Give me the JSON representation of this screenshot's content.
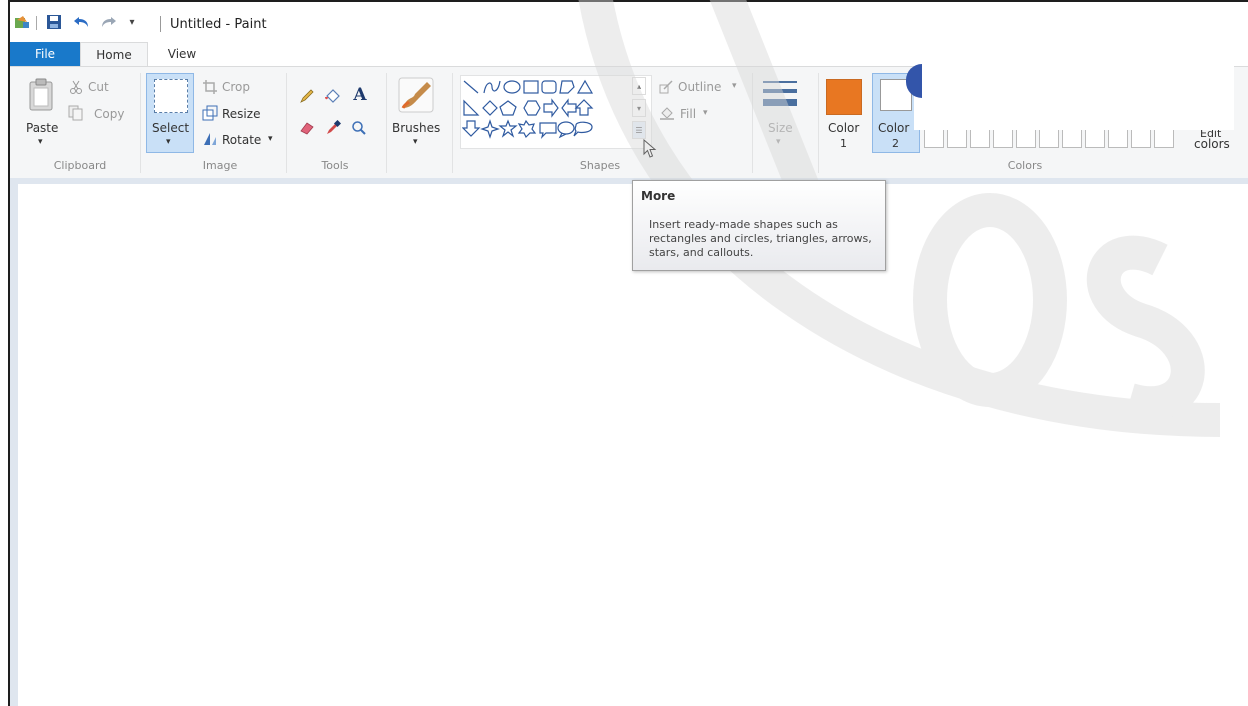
{
  "title": "Untitled - Paint",
  "tabs": {
    "file": "File",
    "home": "Home",
    "view": "View"
  },
  "clipboard": {
    "paste": "Paste",
    "cut": "Cut",
    "copy": "Copy",
    "label": "Clipboard"
  },
  "image": {
    "select": "Select",
    "crop": "Crop",
    "resize": "Resize",
    "rotate": "Rotate",
    "label": "Image"
  },
  "tools": {
    "label": "Tools",
    "text_glyph": "A"
  },
  "brushes": {
    "label": "Brushes"
  },
  "shapes": {
    "outline": "Outline",
    "fill": "Fill",
    "label": "Shapes"
  },
  "size": {
    "label": "Size"
  },
  "colors": {
    "color1": "Color",
    "color1_num": "1",
    "color2": "Color",
    "color2_num": "2",
    "edit": "colors",
    "edit_partial": "Edit",
    "label": "Colors",
    "color1_value": "#e87722",
    "color2_value": "#ffffff"
  },
  "tooltip": {
    "title": "More",
    "body": "Insert ready-made shapes such as rectangles and circles, triangles, arrows, stars, and callouts."
  }
}
